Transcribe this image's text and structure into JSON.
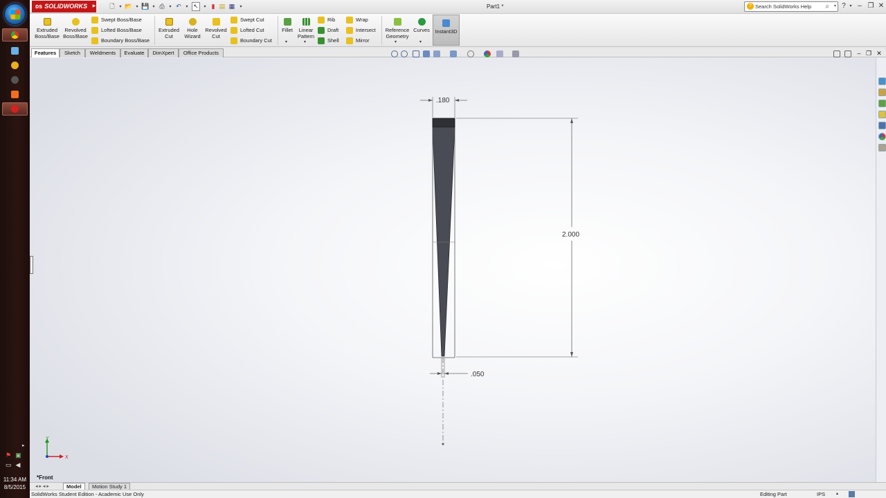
{
  "app": {
    "brand": "SOLIDWORKS",
    "document_title": "Part1 *"
  },
  "search": {
    "placeholder": "Search SolidWorks Help"
  },
  "ribbon": {
    "extruded_boss": "Extruded\nBoss/Base",
    "revolved_boss": "Revolved\nBoss/Base",
    "swept_boss": "Swept Boss/Base",
    "lofted_boss": "Lofted Boss/Base",
    "boundary_boss": "Boundary Boss/Base",
    "extruded_cut": "Extruded\nCut",
    "hole_wizard": "Hole\nWizard",
    "revolved_cut": "Revolved\nCut",
    "swept_cut": "Swept Cut",
    "lofted_cut": "Lofted Cut",
    "boundary_cut": "Boundary Cut",
    "fillet": "Fillet",
    "linear_pattern": "Linear\nPattern",
    "rib": "Rib",
    "draft": "Draft",
    "shell": "Shell",
    "wrap": "Wrap",
    "intersect": "Intersect",
    "mirror": "Mirror",
    "reference_geometry": "Reference\nGeometry",
    "curves": "Curves",
    "instant3d": "Instant3D"
  },
  "tabs": [
    "Features",
    "Sketch",
    "Weldments",
    "Evaluate",
    "DimXpert",
    "Office Products"
  ],
  "drawing": {
    "dim_width_top": ".180",
    "dim_height": "2.000",
    "dim_width_bottom": ".050"
  },
  "triad": {
    "x": "X",
    "y": "Y"
  },
  "view_name": "*Front",
  "bottom_tabs": [
    "Model",
    "Motion Study 1"
  ],
  "status": {
    "left": "SolidWorks Student Edition - Academic Use Only",
    "mode": "Editing Part",
    "units": "IPS"
  },
  "clock": {
    "time": "11:34 AM",
    "date": "8/5/2015"
  },
  "colors": {
    "brand_red": "#c41617",
    "part_fill": "#4a4c55",
    "graphics_bg": "#eef0f4"
  }
}
